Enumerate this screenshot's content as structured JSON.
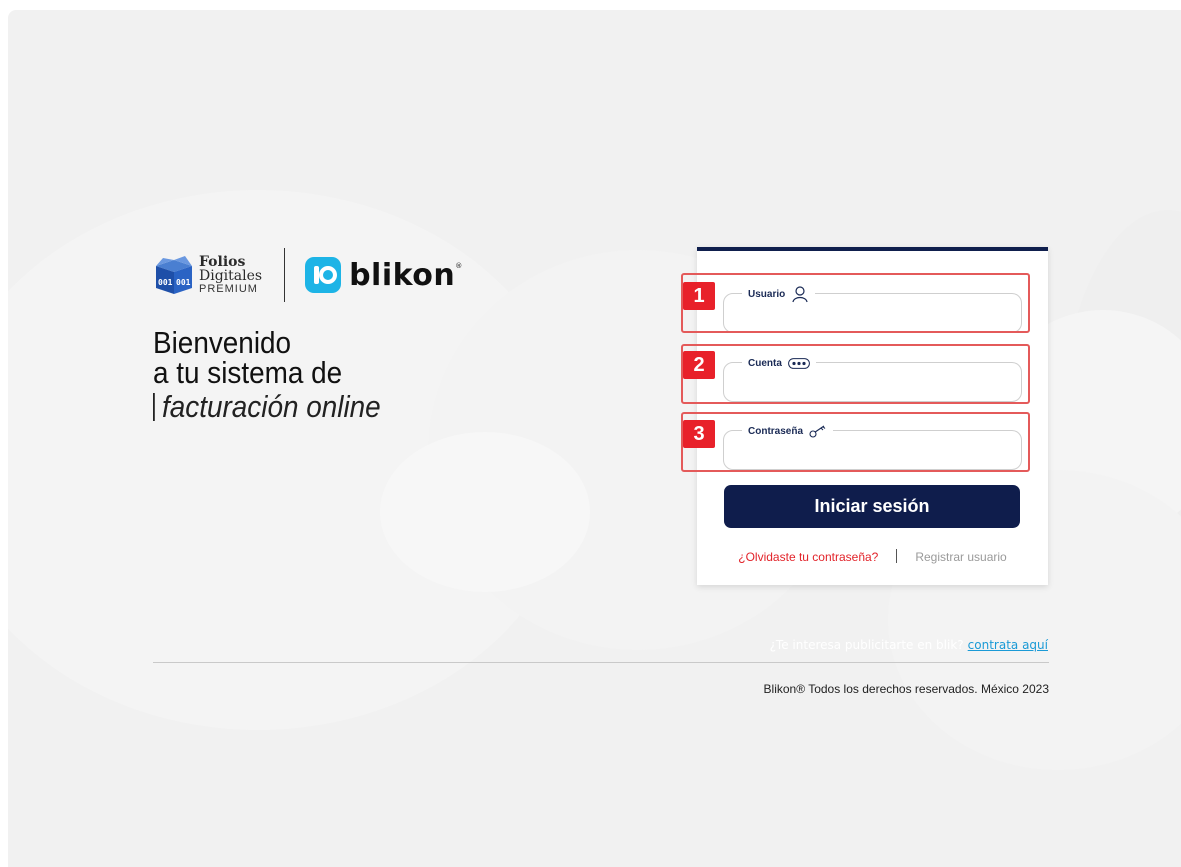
{
  "brand": {
    "folios_line1": "Folios",
    "folios_line2": "Digitales",
    "folios_line3": "PREMIUM",
    "folios_icon": "folios-box-logo",
    "blikon_name": "blikon",
    "blikon_icon": "blikon-logo"
  },
  "welcome": {
    "line1": "Bienvenido",
    "line2": "a tu sistema de",
    "line3": "facturación online"
  },
  "annotations": [
    "1",
    "2",
    "3"
  ],
  "form": {
    "usuario_label": "Usuario",
    "usuario_icon": "user-icon",
    "cuenta_label": "Cuenta",
    "cuenta_icon": "dots-icon",
    "password_label": "Contraseña",
    "password_icon": "key-icon",
    "submit_label": "Iniciar sesión",
    "forgot_label": "¿Olvidaste tu contraseña?",
    "register_label": "Registrar usuario"
  },
  "promo": {
    "question": "¿Te interesa publicitarte en blik?",
    "link": "contrata aquí"
  },
  "footer": {
    "copyright": "Blikon® Todos los derechos reservados. México 2023"
  },
  "colors": {
    "accent_navy": "#0f1d4c",
    "highlight_red": "#e8212a",
    "blikon_blue": "#1db4e6",
    "link_blue": "#1a9ad6"
  }
}
